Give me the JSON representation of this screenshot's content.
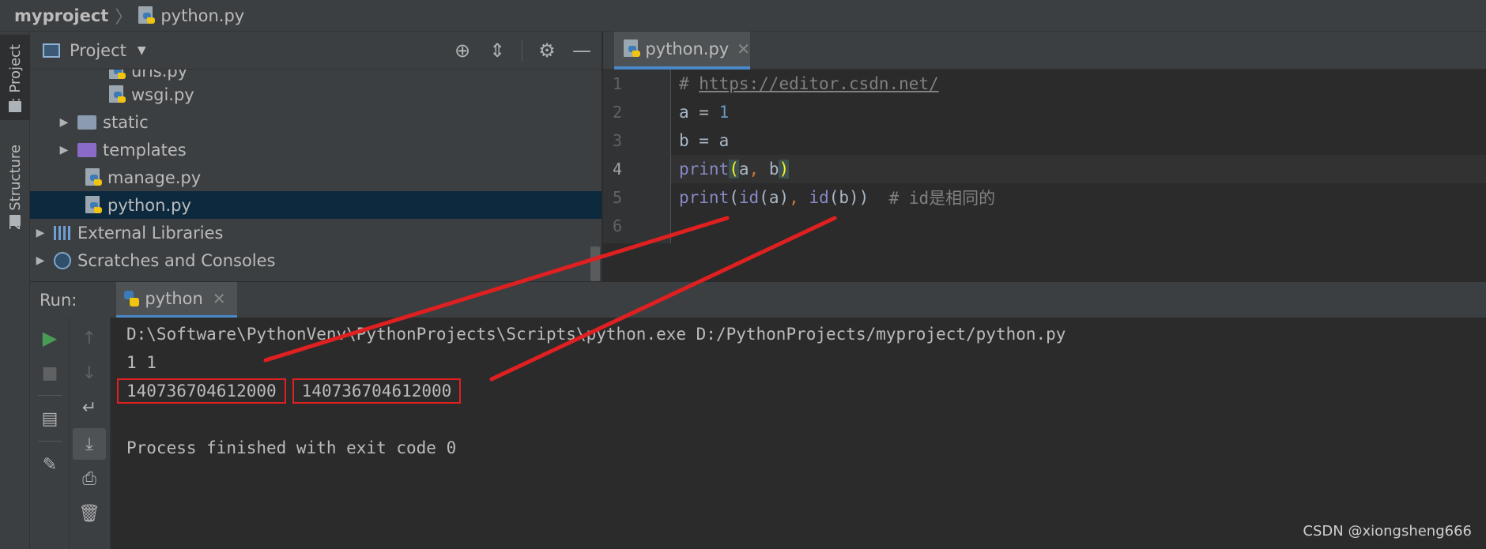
{
  "breadcrumb": {
    "project": "myproject",
    "file": "python.py"
  },
  "left_strip": {
    "tab_project": "1: Project",
    "tab_structure": "Z: Structure"
  },
  "project_panel": {
    "title": "Project",
    "tree": [
      {
        "label": "urls.py",
        "type": "pyfile"
      },
      {
        "label": "wsgi.py",
        "type": "pyfile"
      },
      {
        "label": "static",
        "type": "folder"
      },
      {
        "label": "templates",
        "type": "folder-purple"
      },
      {
        "label": "manage.py",
        "type": "pyfile"
      },
      {
        "label": "python.py",
        "type": "pyfile",
        "selected": true
      },
      {
        "label": "External Libraries",
        "type": "library"
      },
      {
        "label": "Scratches and Consoles",
        "type": "scratches"
      }
    ]
  },
  "editor": {
    "tab_label": "python.py",
    "line_numbers": [
      "1",
      "2",
      "3",
      "4",
      "5",
      "6"
    ],
    "lines": {
      "l1_hash": "# ",
      "l1_link": "https://editor.csdn.net/",
      "l2": "a = ",
      "l2_num": "1",
      "l3": "b = a",
      "l4_fn": "print",
      "l4_open": "(",
      "l4_a": "a",
      "l4_comma": ",",
      "l4_b": " b",
      "l4_close": ")",
      "l5_fn": "print",
      "l5_open": "(",
      "l5_id1": "id",
      "l5_arg1": "(a)",
      "l5_comma": ",",
      "l5_sp": " ",
      "l5_id2": "id",
      "l5_arg2": "(b))",
      "l5_comment": "  # id是相同的"
    }
  },
  "run_panel": {
    "label": "Run:",
    "tab_label": "python",
    "console": {
      "cmd": "D:\\Software\\PythonVenv\\PythonProjects\\Scripts\\python.exe D:/PythonProjects/myproject/python.py",
      "out1": "1 1",
      "id_a": "140736704612000",
      "id_b": "140736704612000",
      "finish": "Process finished with exit code 0"
    }
  },
  "watermark": "CSDN @xiongsheng666",
  "colors": {
    "annotation": "#e02020",
    "accent": "#4a88c7",
    "selection": "#0d293e"
  }
}
